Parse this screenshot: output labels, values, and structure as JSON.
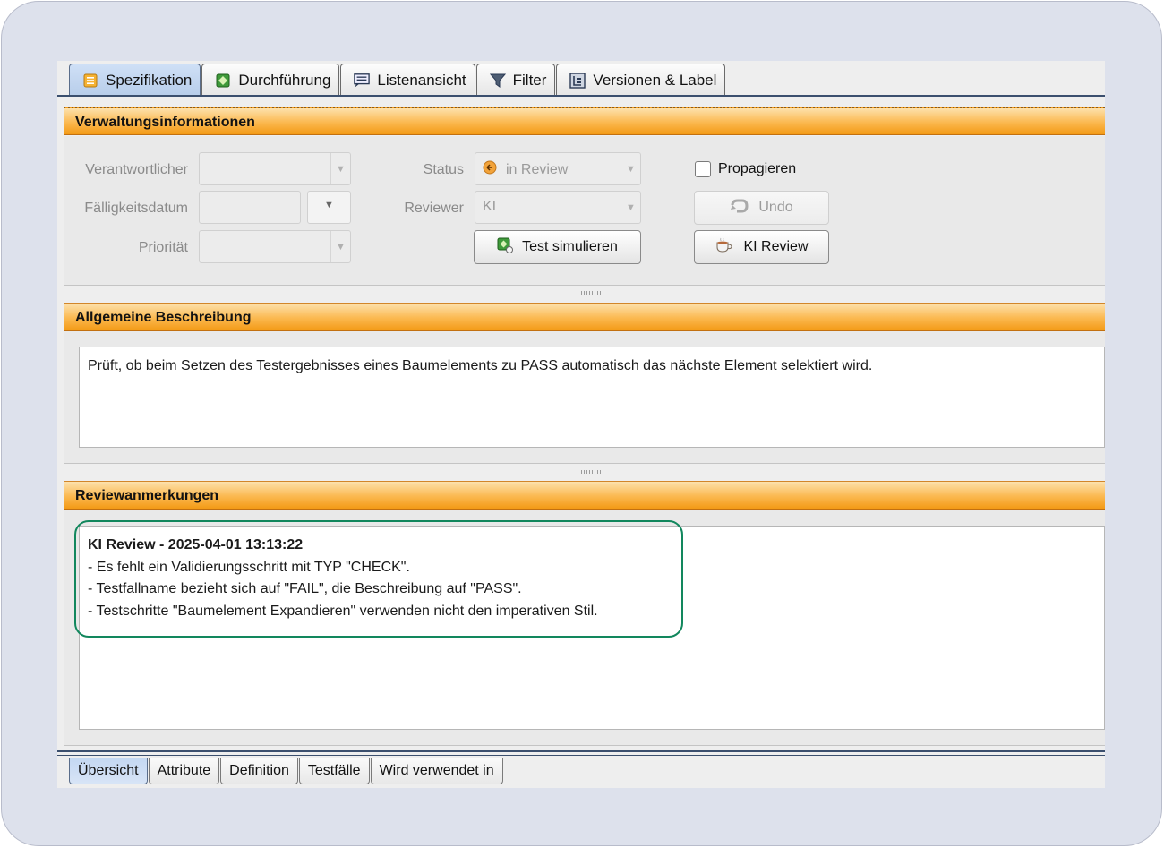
{
  "tabs_top": [
    {
      "label": "Spezifikation",
      "icon": "specification-icon",
      "active": true
    },
    {
      "label": "Durchführung",
      "icon": "execution-icon",
      "active": false
    },
    {
      "label": "Listenansicht",
      "icon": "list-view-icon",
      "active": false
    },
    {
      "label": "Filter",
      "icon": "filter-icon",
      "active": false
    },
    {
      "label": "Versionen & Label",
      "icon": "versions-icon",
      "active": false
    }
  ],
  "admin": {
    "title": "Verwaltungsinformationen",
    "responsible_label": "Verantwortlicher",
    "due_date_label": "Fälligkeitsdatum",
    "priority_label": "Priorität",
    "status_label": "Status",
    "status_value": "in Review",
    "reviewer_label": "Reviewer",
    "reviewer_value": "KI",
    "simulate_button": "Test simulieren",
    "propagate_label": "Propagieren",
    "undo_button": "Undo",
    "ai_review_button": "KI Review"
  },
  "description": {
    "title": "Allgemeine Beschreibung",
    "text": "Prüft, ob beim Setzen des Testergebnisses eines Baumelements zu PASS automatisch das nächste Element selektiert wird."
  },
  "review": {
    "title": "Reviewanmerkungen",
    "heading": "KI Review - 2025-04-01 13:13:22",
    "lines": [
      "- Es fehlt ein Validierungsschritt mit TYP \"CHECK\".",
      "- Testfallname bezieht sich auf \"FAIL\", die Beschreibung auf \"PASS\".",
      "- Testschritte \"Baumelement Expandieren\" verwenden nicht den imperativen Stil."
    ]
  },
  "tabs_bottom": [
    {
      "label": "Übersicht",
      "active": true
    },
    {
      "label": "Attribute",
      "active": false
    },
    {
      "label": "Definition",
      "active": false
    },
    {
      "label": "Testfälle",
      "active": false
    },
    {
      "label": "Wird verwendet in",
      "active": false
    }
  ],
  "colors": {
    "section_header": "#f7a730",
    "highlight_border": "#12875d",
    "active_tab": "#c3d7f2"
  }
}
